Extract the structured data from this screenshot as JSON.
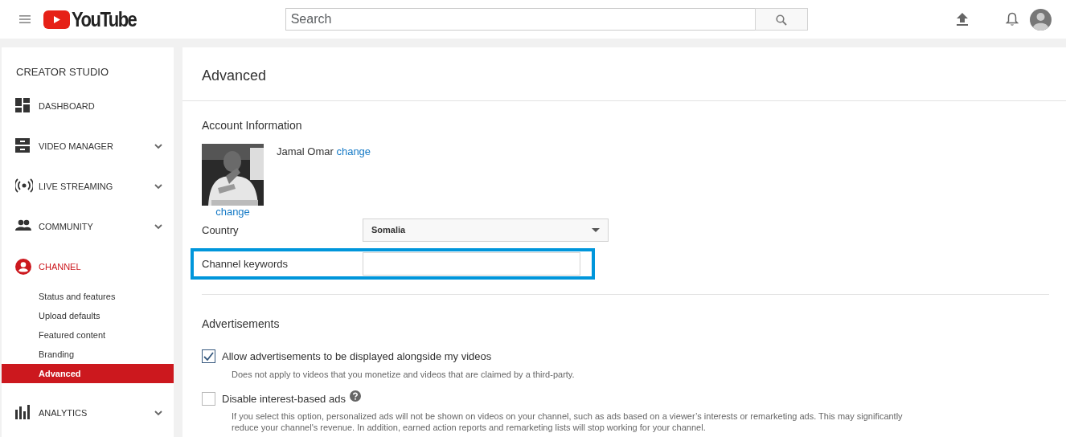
{
  "header": {
    "logo_text": "YouTube",
    "search": {
      "placeholder": "Search"
    }
  },
  "sidebar": {
    "title": "CREATOR STUDIO",
    "items": [
      {
        "label": "DASHBOARD",
        "expandable": false,
        "selected": false
      },
      {
        "label": "VIDEO MANAGER",
        "expandable": true,
        "selected": false
      },
      {
        "label": "LIVE STREAMING",
        "expandable": true,
        "selected": false
      },
      {
        "label": "COMMUNITY",
        "expandable": true,
        "selected": false
      },
      {
        "label": "CHANNEL",
        "expandable": false,
        "selected": true,
        "children": [
          {
            "label": "Status and features",
            "selected": false
          },
          {
            "label": "Upload defaults",
            "selected": false
          },
          {
            "label": "Featured content",
            "selected": false
          },
          {
            "label": "Branding",
            "selected": false
          },
          {
            "label": "Advanced",
            "selected": true
          }
        ]
      },
      {
        "label": "ANALYTICS",
        "expandable": true,
        "selected": false
      }
    ]
  },
  "main": {
    "title": "Advanced",
    "account": {
      "heading": "Account Information",
      "name": "Jamal Omar",
      "name_link": "change",
      "photo_link": "change",
      "country": {
        "label": "Country",
        "value": "Somalia"
      },
      "keywords": {
        "label": "Channel keywords",
        "highlighted": true
      }
    },
    "ads": {
      "heading": "Advertisements",
      "options": [
        {
          "label": "Allow advertisements to be displayed alongside my videos",
          "checked": true,
          "help": false,
          "note": "Does not apply to videos that you monetize and videos that are claimed by a third-party."
        },
        {
          "label": "Disable interest-based ads",
          "checked": false,
          "help": true,
          "note": "If you select this option, personalized ads will not be shown on videos on your channel, such as ads based on a viewer’s interests or remarketing ads. This may significantly reduce your channel's revenue. In addition, earned action reports and remarketing lists will stop working for your channel."
        }
      ]
    }
  }
}
